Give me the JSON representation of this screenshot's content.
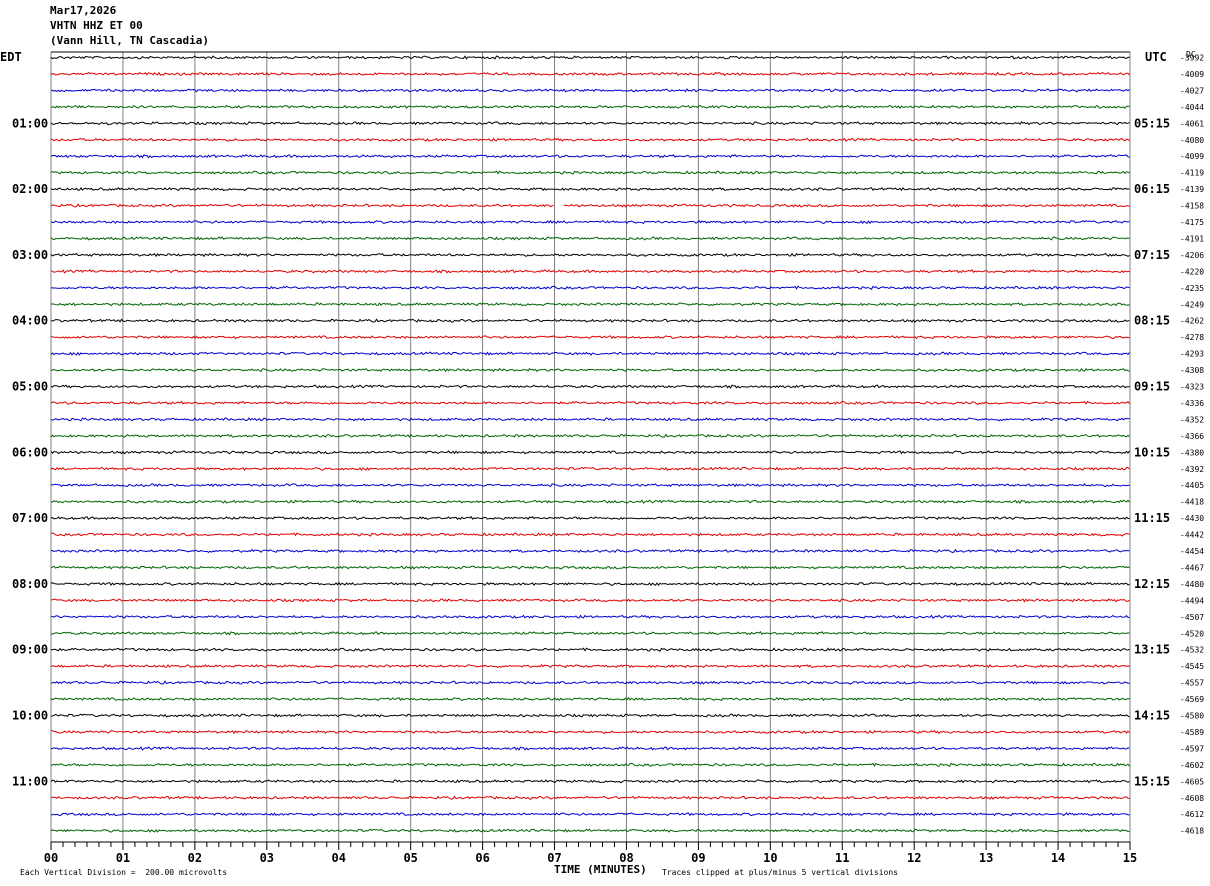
{
  "header": {
    "date": "Mar17,2026",
    "station": "VHTN HHZ ET 00",
    "location": "(Vann Hill, TN Cascadia)"
  },
  "left_zone_label": "EDT",
  "right_zone_label": "UTC",
  "dc_label": "DC",
  "footer": {
    "scale_note": "Each Vertical Division =  200.00 microvolts",
    "xlabel": "TIME (MINUTES)",
    "clip_note": "Traces clipped at plus/minus 5 vertical divisions"
  },
  "colors": {
    "trace_cycle": [
      "#000000",
      "#e00000",
      "#0000d0",
      "#006400"
    ],
    "grid": "#808080",
    "frame": "#000000"
  },
  "chart_data": {
    "type": "line",
    "subtype": "helicorder",
    "x_ticks": [
      "00",
      "01",
      "02",
      "03",
      "04",
      "05",
      "06",
      "07",
      "08",
      "09",
      "10",
      "11",
      "12",
      "13",
      "14",
      "15"
    ],
    "xlim": [
      0,
      15
    ],
    "x_unit": "minutes",
    "left_time_labels": [
      {
        "row": 0,
        "text": ""
      },
      {
        "row": 4,
        "text": "01:00"
      },
      {
        "row": 8,
        "text": "02:00"
      },
      {
        "row": 12,
        "text": "03:00"
      },
      {
        "row": 16,
        "text": "04:00"
      },
      {
        "row": 20,
        "text": "05:00"
      },
      {
        "row": 24,
        "text": "06:00"
      },
      {
        "row": 28,
        "text": "07:00"
      },
      {
        "row": 32,
        "text": "08:00"
      },
      {
        "row": 36,
        "text": "09:00"
      },
      {
        "row": 40,
        "text": "10:00"
      },
      {
        "row": 44,
        "text": "11:00"
      }
    ],
    "right_time_labels": [
      {
        "row": 4,
        "text": "05:15"
      },
      {
        "row": 8,
        "text": "06:15"
      },
      {
        "row": 12,
        "text": "07:15"
      },
      {
        "row": 16,
        "text": "08:15"
      },
      {
        "row": 20,
        "text": "09:15"
      },
      {
        "row": 24,
        "text": "10:15"
      },
      {
        "row": 28,
        "text": "11:15"
      },
      {
        "row": 32,
        "text": "12:15"
      },
      {
        "row": 36,
        "text": "13:15"
      },
      {
        "row": 40,
        "text": "14:15"
      },
      {
        "row": 44,
        "text": "15:15"
      }
    ],
    "dc_offsets": [
      "-3992",
      "-4009",
      "-4027",
      "-4044",
      "-4061",
      "-4080",
      "-4099",
      "-4119",
      "-4139",
      "-4158",
      "-4175",
      "-4191",
      "-4206",
      "-4220",
      "-4235",
      "-4249",
      "-4262",
      "-4278",
      "-4293",
      "-4308",
      "-4323",
      "-4336",
      "-4352",
      "-4366",
      "-4380",
      "-4392",
      "-4405",
      "-4418",
      "-4430",
      "-4442",
      "-4454",
      "-4467",
      "-4480",
      "-4494",
      "-4507",
      "-4520",
      "-4532",
      "-4545",
      "-4557",
      "-4569",
      "-4580",
      "-4589",
      "-4597",
      "-4602",
      "-4605",
      "-4608",
      "-4612",
      "-4618"
    ],
    "rows": 48,
    "gap": {
      "row": 9,
      "x_start": 6.99,
      "x_end": 7.12
    }
  }
}
